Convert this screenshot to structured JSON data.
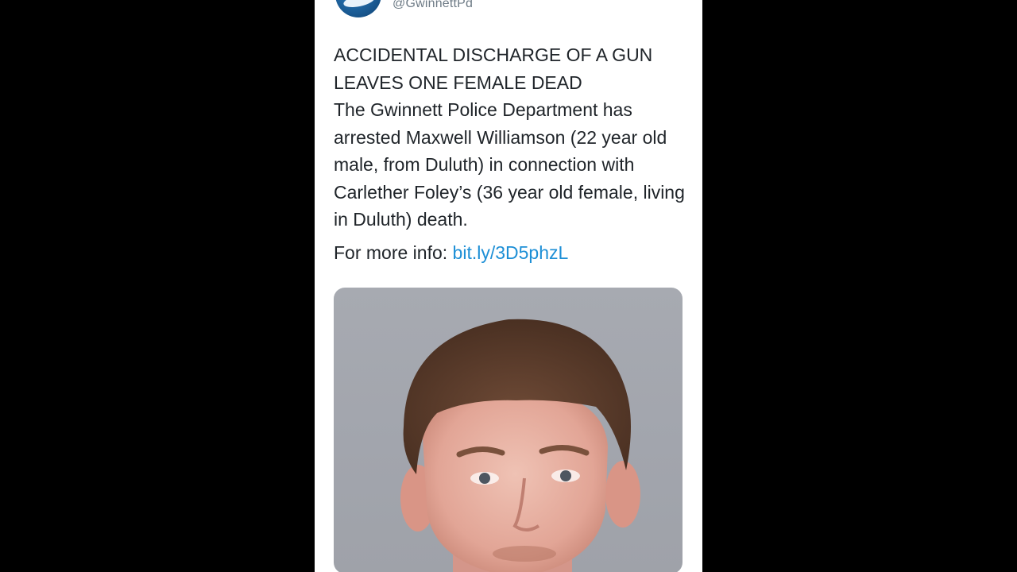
{
  "tweet": {
    "handle": "@GwinnettPd",
    "headline_line1": "ACCIDENTAL DISCHARGE OF A GUN",
    "headline_line2": "LEAVES ONE FEMALE DEAD",
    "body": "The Gwinnett Police Department has arrested Maxwell Williamson (22 year old male, from Duluth) in connection with Carlether Foley’s (36 year old female, living in Duluth) death.",
    "more_info_label": "For more info: ",
    "link_text": "bit.ly/3D5phzL"
  },
  "colors": {
    "background": "#000000",
    "card": "#ffffff",
    "text": "#1f2429",
    "link": "#1d8fd6",
    "handle": "#6e7b86",
    "photo_backdrop": "#a5a8af"
  },
  "icons": {
    "avatar": "gwinnett-police-logo",
    "media": "mugshot-photo"
  }
}
